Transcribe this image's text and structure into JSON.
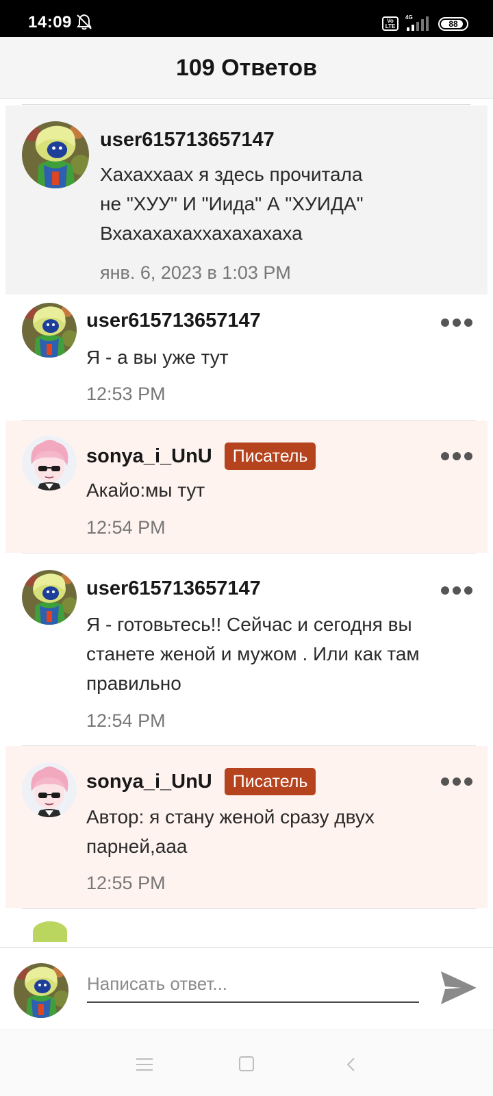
{
  "status": {
    "time": "14:09",
    "network": "4G",
    "battery": "88",
    "battery_level": 0.88
  },
  "header": {
    "title": "109 Ответов"
  },
  "parent_comment": {
    "username": "user615713657147",
    "text": "Хахаххаах я здесь прочитала\nне \"ХУУ\" И \"Иида\" А \"ХУИДА\"\nВхахахахаххахахахаха",
    "time": "янв. 6, 2023 в 1:03 PM"
  },
  "replies": [
    {
      "username": "user615713657147",
      "badge": "",
      "text": "Я - а вы уже тут",
      "time": "12:53 PM"
    },
    {
      "username": "sonya_i_UnU",
      "badge": "Писатель",
      "text": "Акайо:мы тут",
      "time": "12:54 PM"
    },
    {
      "username": "user615713657147",
      "badge": "",
      "text": "Я - готовьтесь!! Сейчас и сегодня вы\nстанете женой и мужом  . Или как там\nправильно",
      "time": "12:54 PM"
    },
    {
      "username": "sonya_i_UnU",
      "badge": "Писатель",
      "text": "Автор: я стану женой сразу двух\nпарней,ааа",
      "time": "12:55 PM"
    }
  ],
  "reply_bar": {
    "placeholder": "Написать ответ..."
  },
  "colors": {
    "writer_badge": "#b5431d",
    "writer_bg": "#fff3f0",
    "parent_bg": "#f3f3f3"
  }
}
